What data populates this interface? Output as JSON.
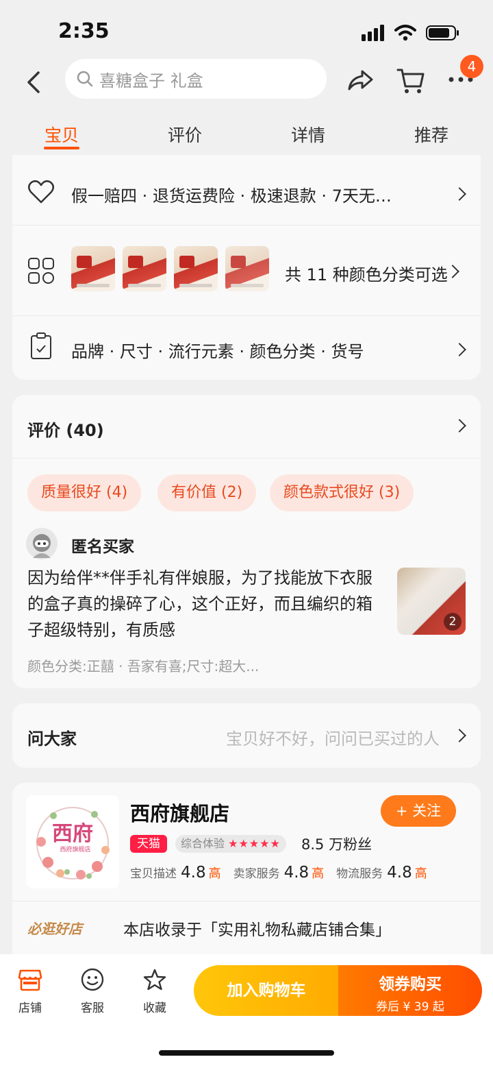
{
  "status_bar": {
    "time": "2:35"
  },
  "header": {
    "search_placeholder": "喜糖盒子 礼盒",
    "more_badge": "4"
  },
  "tabs": [
    {
      "label": "宝贝",
      "active": true
    },
    {
      "label": "评价",
      "active": false
    },
    {
      "label": "详情",
      "active": false
    },
    {
      "label": "推荐",
      "active": false
    }
  ],
  "guarantee": {
    "text": "假一赔四 · 退货运费险 · 极速退款 · 7天无…",
    "variants_text": "共 11 种颜色分类可选",
    "params_text": "品牌 · 尺寸 · 流行元素 · 颜色分类 · 货号"
  },
  "reviews": {
    "title": "评价 (40)",
    "tags": [
      "质量很好 (4)",
      "有价值 (2)",
      "颜色款式很好 (3)"
    ],
    "reviewer": "匿名买家",
    "content": "因为给伴**伴手礼有伴娘服，为了找能放下衣服的盒子真的操碎了心，这个正好，而且编织的箱子超级特别，有质感",
    "meta": "颜色分类:正囍 · 吾家有喜;尺寸:超大...",
    "image_count": "2"
  },
  "ask": {
    "title": "问大家",
    "hint": "宝贝好不好，问问已买过的人"
  },
  "shop": {
    "logo_text": "西府",
    "logo_sub": "西府旗舰店",
    "name": "西府旗舰店",
    "follow_label": "+ 关注",
    "tmall_label": "天猫",
    "experience_label": "综合体验",
    "experience_stars": "★★★★★",
    "fans": "8.5 万粉丝",
    "scores": [
      {
        "label": "宝贝描述",
        "value": "4.8",
        "level": "高"
      },
      {
        "label": "卖家服务",
        "value": "4.8",
        "level": "高"
      },
      {
        "label": "物流服务",
        "value": "4.8",
        "level": "高"
      }
    ],
    "recommend_tag": "必逛好店",
    "recommend_text": "本店收录于「实用礼物私藏店铺合集」"
  },
  "bottom_bar": {
    "store_label": "店铺",
    "service_label": "客服",
    "favorite_label": "收藏",
    "add_cart_label": "加入购物车",
    "buy_label": "领券购买",
    "buy_sub": "券后 ¥ 39 起"
  },
  "colors": {
    "accent": "#ff5000",
    "tag_bg": "#fde6df",
    "tmall_red": "#ff1e44"
  }
}
